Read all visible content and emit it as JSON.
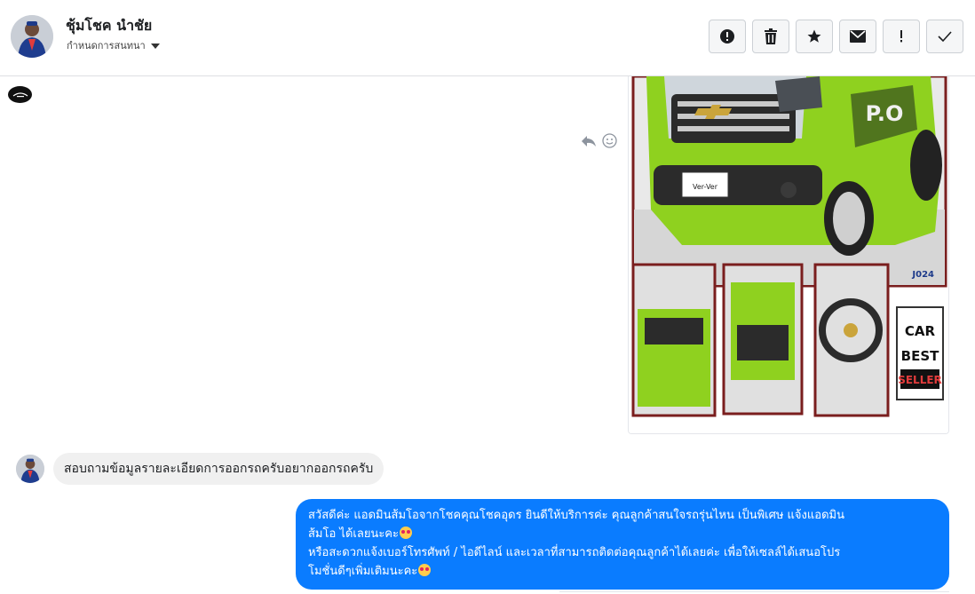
{
  "header": {
    "contact_name": "ชุ้มโชค นำชัย",
    "conversation_status": "กำหนดการสนทนา",
    "actions": [
      {
        "id": "spam",
        "icon": "alert-circle-icon"
      },
      {
        "id": "delete",
        "icon": "trash-icon"
      },
      {
        "id": "star",
        "icon": "star-icon"
      },
      {
        "id": "mark-unread",
        "icon": "envelope-icon"
      },
      {
        "id": "important",
        "icon": "exclamation-icon"
      },
      {
        "id": "done",
        "icon": "checkmark-icon"
      }
    ]
  },
  "image_card": {
    "plate_text": "Ver-Ver",
    "watermark": "J024",
    "badge": {
      "line1": "CAR",
      "line2": "BEST",
      "line3": "SELLER"
    },
    "vehicle_decal": "P.O",
    "colors": {
      "car_green": "#8fd11f",
      "car_dark": "#2b2b2b",
      "frame": "#7a1e1e"
    }
  },
  "messages": [
    {
      "direction": "incoming",
      "text": "สอบถามข้อมูลรายละเอียดการออกรถครับอยากออกรถครับ"
    },
    {
      "direction": "outgoing",
      "line1": "สวัสดีค่ะ แอดมินส้มโอจากโชคคุณโชคอุดร ยินดีให้บริการค่ะ   คุณลูกค้าสนใจรถรุ่นไหน เป็นพิเศษ แจ้งแอดมิน",
      "line2": "ส้มโอ ได้เลยนะคะ",
      "line3": "หรือสะดวกแจ้งเบอร์โทรศัพท์ / ไอดีไลน์ และเวลาที่สามารถติดต่อคุณลูกค้าได้เลยค่ะ เพื่อให้เซลล์ได้เสนอโปร",
      "line4": "โมชั่นดีๆเพิ่มเติมนะคะ"
    }
  ],
  "colors": {
    "outgoing_bubble": "#0a7cff",
    "incoming_bubble": "#f0f0f0"
  }
}
